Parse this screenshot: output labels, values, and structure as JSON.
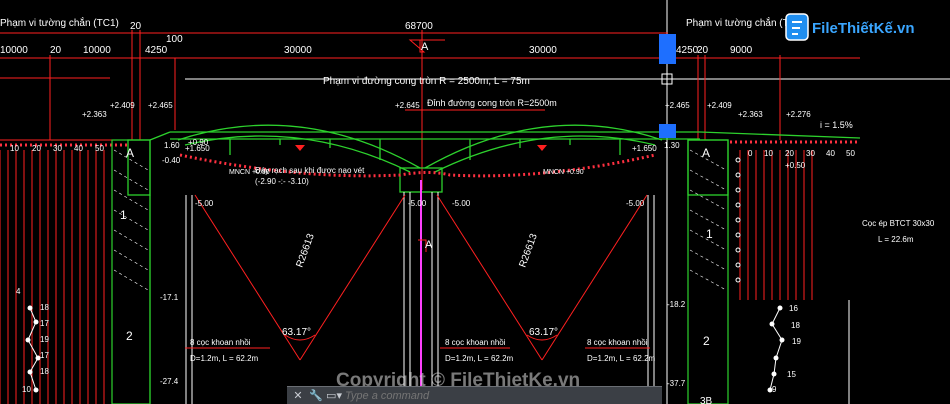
{
  "colors": {
    "dim": "#ff2020",
    "struct": "#2dd12d",
    "white": "#ffffff",
    "yellow": "#ffff40",
    "blue": "#1e6fff",
    "magenta": "#ff40ff",
    "pink": "#ff6aa0"
  },
  "top_dims": {
    "total": "68700",
    "left_wall_label": "Phạm vi tường chắn (TC1)",
    "right_wall_label": "Phạm vi tường chắn (TC2)",
    "left_values": [
      "10000",
      "20",
      "10000",
      "20",
      "4250",
      "100"
    ],
    "span1": "30000",
    "span2": "30000",
    "right_values": [
      "4250",
      "20",
      "9000"
    ],
    "section_mark": "A"
  },
  "curve_label": "Phạm vi đường cong tròn R = 2500m, L = 75m",
  "curve_note": "Đỉnh đường cong tròn R=2500m",
  "elevations": {
    "e1": "+2.409",
    "e2": "+2.363",
    "e3": "+2.465",
    "e4": "+2.645",
    "e5": "+2.465",
    "e6": "+2.409",
    "e7": "+2.363",
    "e8": "+2.276",
    "e9": "+1.650",
    "e10": "+1.650",
    "e11": "-0.40",
    "e12": "+0.90",
    "e13": "1.30",
    "e14": "-5.00",
    "e15": "-5.00",
    "e16": "-5.00",
    "e17": "-5.00",
    "e18": "-17.1",
    "e19": "-18.2",
    "e20": "-27.4",
    "e21": "-37.7",
    "e22": "+0.50",
    "e23": "1.60"
  },
  "slope": "i = 1.5%",
  "mncn_left": "MNCN +0.90",
  "mncn_right": "MNCN +0.90",
  "dredge_note": [
    "Đáy rạch sau khi được nạo vét",
    "(-2.90 -:- -3.10)"
  ],
  "radius_left": "R26613",
  "radius_right": "R26613",
  "angle_left": "63.17°",
  "angle_right": "63.17°",
  "piles": [
    {
      "title": "8 cọc khoan nhồi",
      "spec": "D=1.2m, L = 62.2m"
    },
    {
      "title": "8 cọc khoan nhồi",
      "spec": "D=1.2m, L = 62.2m"
    },
    {
      "title": "8 cọc khoan nhồi",
      "spec": "D=1.2m, L = 62.2m"
    }
  ],
  "precast_pile": {
    "title": "Cọc ép BTCT 30x30",
    "length": "L = 22.6m"
  },
  "abut_left": {
    "top": "A",
    "mid1": "1",
    "mid2": "2"
  },
  "abut_right": {
    "top": "A",
    "mid1": "1",
    "mid2": "2",
    "bottom": "3B"
  },
  "left_soil_numbers": [
    "4",
    "18",
    "17",
    "19",
    "17",
    "18",
    "10"
  ],
  "right_soil_numbers": [
    "16",
    "18",
    "19",
    "15",
    "9"
  ],
  "right_ground_ticks": [
    "0",
    "10",
    "20",
    "30",
    "40",
    "50"
  ],
  "left_ground_ticks": [
    "10",
    "20",
    "30",
    "40",
    "50"
  ],
  "command_bar": {
    "placeholder": "Type a command"
  },
  "logo": {
    "text": "FileThiếtKế.vn"
  },
  "watermark": "Copyright © FileThietKe.vn"
}
